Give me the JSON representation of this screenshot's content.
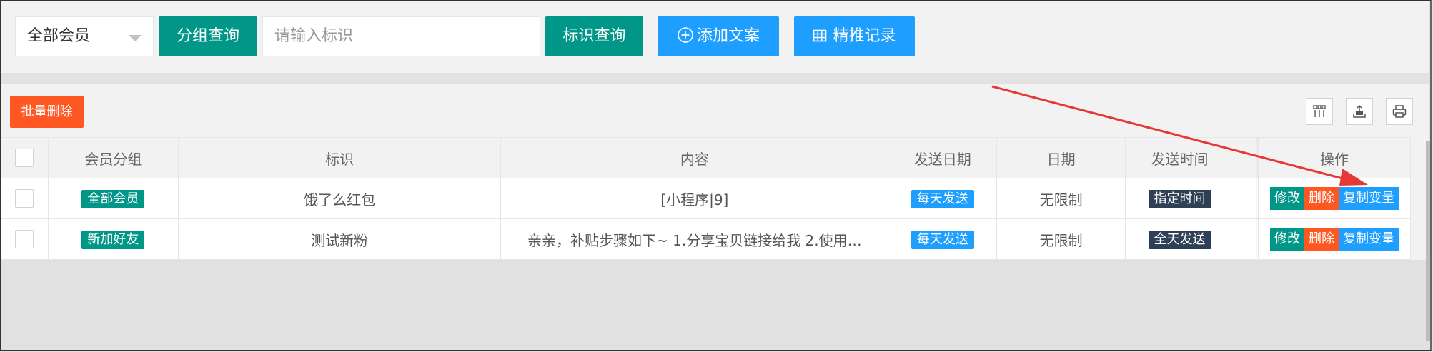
{
  "toolbar": {
    "group_select_value": "全部会员",
    "group_query_label": "分组查询",
    "tag_input_placeholder": "请输入标识",
    "tag_query_label": "标识查询",
    "add_copy_label": "添加文案",
    "push_record_label": "精推记录"
  },
  "actions": {
    "batch_delete_label": "批量删除"
  },
  "table": {
    "headers": {
      "group": "会员分组",
      "tag": "标识",
      "content": "内容",
      "send_date": "发送日期",
      "date": "日期",
      "send_time": "发送时间",
      "ops": "操作"
    },
    "rows": [
      {
        "group": "全部会员",
        "tag": "饿了么红包",
        "content": "[小程序|9]",
        "send_date": "每天发送",
        "date": "无限制",
        "send_time": "指定时间",
        "edit": "修改",
        "delete": "删除",
        "copy_var": "复制变量"
      },
      {
        "group": "新加好友",
        "tag": "测试新粉",
        "content": "亲亲，补贴步骤如下~ 1.分享宝贝链接给我 2.使用…",
        "send_date": "每天发送",
        "date": "无限制",
        "send_time": "全天发送",
        "edit": "修改",
        "delete": "删除",
        "copy_var": "复制变量"
      }
    ]
  },
  "icons": {
    "columns": "columns-icon",
    "export": "export-icon",
    "print": "print-icon",
    "plus_circle": "plus-circle-icon",
    "grid": "grid-icon"
  },
  "colors": {
    "teal": "#009688",
    "blue": "#1e9fff",
    "orange_red": "#ff5722",
    "dark": "#2f4056",
    "annotation_arrow": "#e53935"
  }
}
